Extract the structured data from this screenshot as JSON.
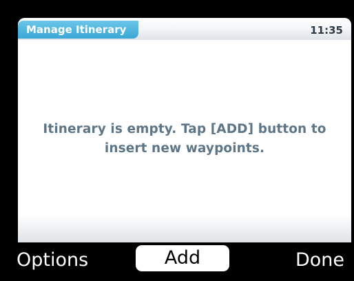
{
  "header": {
    "title": "Manage Itinerary",
    "time": "11:35"
  },
  "message": {
    "line1": "Itinerary is empty. Tap [ADD]  button to",
    "line2": "insert new waypoints."
  },
  "softkeys": {
    "options_label": "Options",
    "add_label": "Add",
    "done_label": "Done"
  },
  "colors": {
    "title_badge": "#3aa7d6",
    "message_text": "#5d7586",
    "background": "#000000"
  }
}
